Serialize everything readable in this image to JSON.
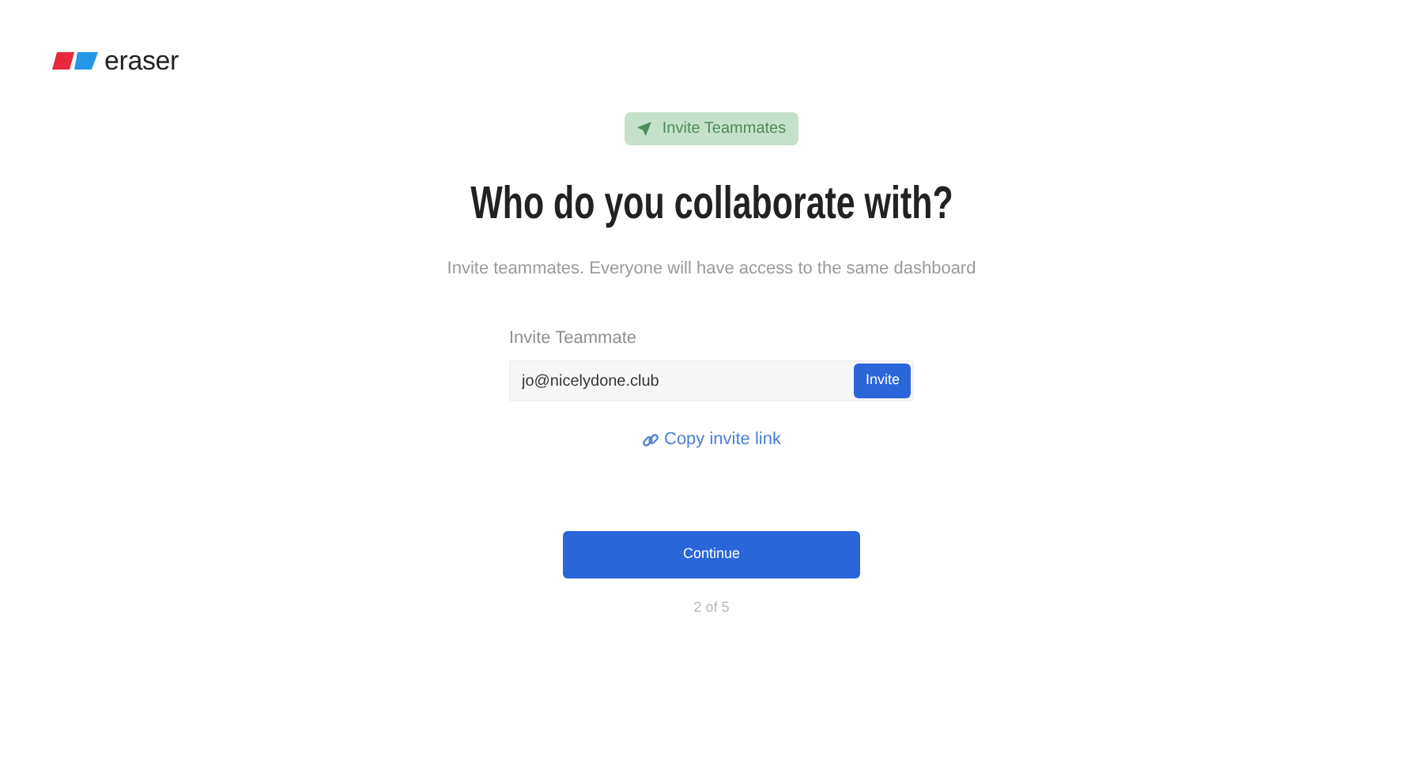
{
  "logo": {
    "text": "eraser"
  },
  "badge": {
    "label": "Invite Teammates"
  },
  "heading": "Who do you collaborate with?",
  "subtitle": "Invite teammates. Everyone will have access to the same dashboard",
  "invite_form": {
    "label": "Invite Teammate",
    "value": "jo@nicelydone.club",
    "button": "Invite"
  },
  "copy_link": "Copy invite link",
  "continue_button": "Continue",
  "step": "2 of 5"
}
